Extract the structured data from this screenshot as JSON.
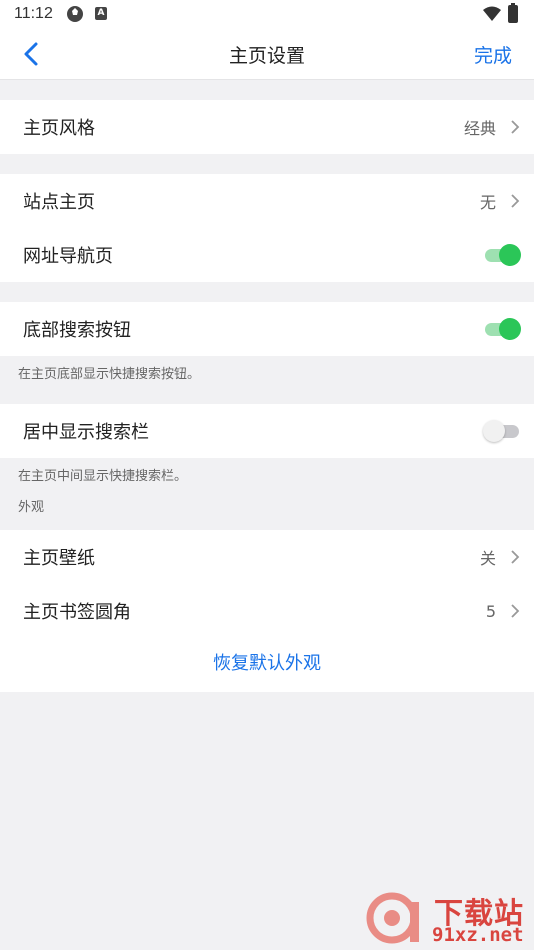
{
  "status_bar": {
    "time": "11:12",
    "badge": "A"
  },
  "header": {
    "title": "主页设置",
    "done_label": "完成"
  },
  "groups": {
    "style": {
      "label": "主页风格",
      "value": "经典"
    },
    "site_home": {
      "label": "站点主页",
      "value": "无"
    },
    "nav_page": {
      "label": "网址导航页",
      "enabled": true
    },
    "bottom_search": {
      "label": "底部搜索按钮",
      "enabled": true,
      "hint": "在主页底部显示快捷搜索按钮。"
    },
    "center_search": {
      "label": "居中显示搜索栏",
      "enabled": false,
      "hint": "在主页中间显示快捷搜索栏。"
    }
  },
  "appearance": {
    "header": "外观",
    "wallpaper": {
      "label": "主页壁纸",
      "value": "关"
    },
    "bookmark_radius": {
      "label": "主页书签圆角",
      "value": "5"
    },
    "restore_label": "恢复默认外观"
  },
  "watermark": {
    "top": "下载站",
    "bottom": "91xz.net"
  },
  "colors": {
    "accent": "#1a73e8",
    "toggle_on": "#2bc658",
    "background": "#f1f1f3"
  }
}
